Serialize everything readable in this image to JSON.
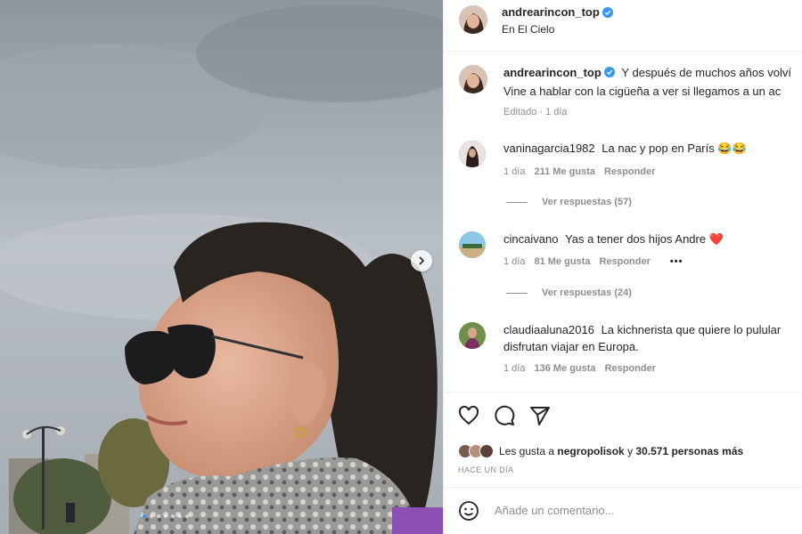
{
  "post": {
    "username": "andrearincon_top",
    "location": "En El Cielo",
    "images_count": 7,
    "current_image": 0
  },
  "caption": {
    "username": "andrearincon_top",
    "line1": "Y después de muchos años volví",
    "line2": "Vine a hablar con la cigüeña a ver si llegamos a un ac",
    "meta": "Editado · 1 día"
  },
  "comments": [
    {
      "username": "vaninagarcia1982",
      "text": "La nac y pop en París 😂😂",
      "time": "1 día",
      "likes": "211 Me gusta",
      "reply": "Responder",
      "view_replies": "Ver respuestas (57)"
    },
    {
      "username": "cincaivano",
      "text": "Yas a tener dos hijos Andre ❤️",
      "time": "1 día",
      "likes": "81 Me gusta",
      "reply": "Responder",
      "more": "•••",
      "view_replies": "Ver respuestas (24)"
    },
    {
      "username": "claudiaaluna2016",
      "text_line1": "La kichnerista que quiere lo pulular",
      "text_line2": "disfrutan viajar en Europa.",
      "time": "1 día",
      "likes": "136 Me gusta",
      "reply": "Responder"
    }
  ],
  "actions": {
    "icons": [
      "heart-icon",
      "comment-icon",
      "share-icon"
    ],
    "likes_prefix": "Les gusta a",
    "likes_user": "negropolisok",
    "likes_joiner": "y",
    "likes_count": "30.571 personas más",
    "time_ago": "HACE UN DÍA"
  },
  "add_comment": {
    "placeholder": "Añade un comentario..."
  },
  "colors": {
    "verified": "#3897f0",
    "heart": "#ed1c24",
    "muted": "#8e8e8e"
  }
}
